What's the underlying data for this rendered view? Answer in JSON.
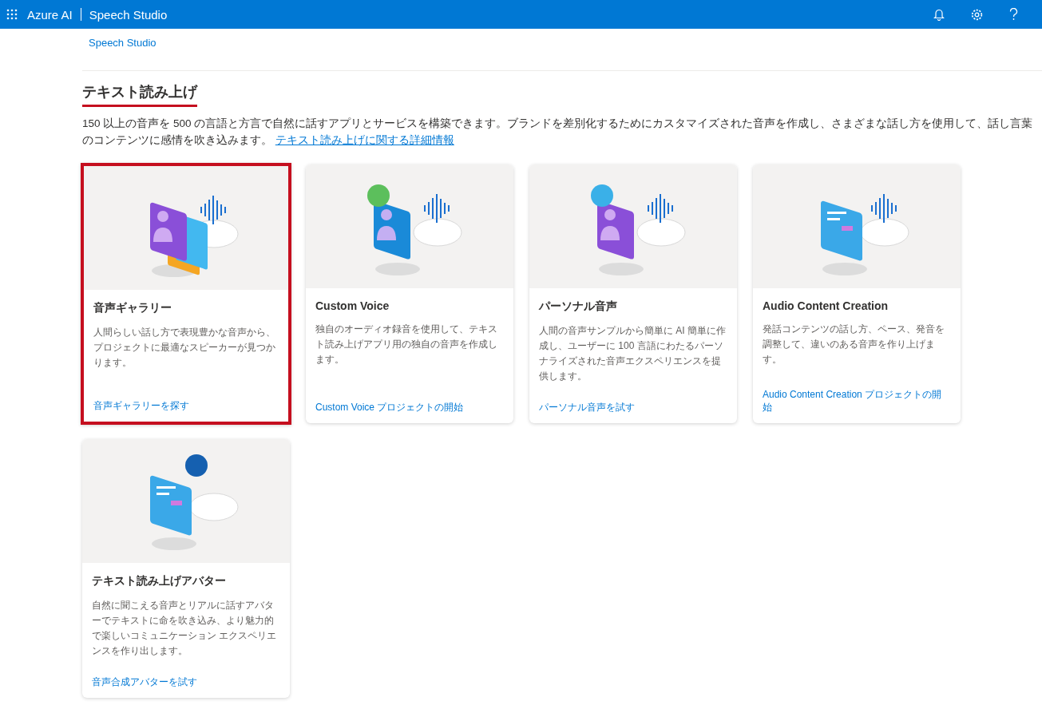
{
  "topbar": {
    "brand": "Azure AI",
    "product": "Speech Studio"
  },
  "breadcrumb": "Speech Studio",
  "heading": "テキスト読み上げ",
  "intro": {
    "text": "150 以上の音声を 500 の言語と方言で自然に話すアプリとサービスを構築できます。ブランドを差別化するためにカスタマイズされた音声を作成し、さまざまな話し方を使用して、話し言葉のコンテンツに感情を吹き込みます。",
    "link": "テキスト読み上げに関する詳細情報"
  },
  "cards": [
    {
      "kind": "gallery",
      "title": "音声ギャラリー",
      "description": "人間らしい話し方で表現豊かな音声から、プロジェクトに最適なスピーカーが見つかります。",
      "link": "音声ギャラリーを探す",
      "selected": true
    },
    {
      "kind": "custom",
      "title": "Custom Voice",
      "description": "独自のオーディオ録音を使用して、テキスト読み上げアプリ用の独自の音声を作成します。",
      "link": "Custom Voice プロジェクトの開始",
      "selected": false
    },
    {
      "kind": "personal",
      "title": "パーソナル音声",
      "description": "人間の音声サンプルから簡単に AI 簡単に作成し、ユーザーに 100 言語にわたるパーソナライズされた音声エクスペリエンスを提供します。",
      "link": "パーソナル音声を試す",
      "selected": false
    },
    {
      "kind": "content",
      "title": "Audio Content Creation",
      "description": "発話コンテンツの話し方、ペース、発音を調整して、違いのある音声を作り上げます。",
      "link": "Audio Content Creation プロジェクトの開始",
      "selected": false
    },
    {
      "kind": "avatar",
      "title": "テキスト読み上げアバター",
      "description": "自然に聞こえる音声とリアルに話すアバターでテキストに命を吹き込み、より魅力的で楽しいコミュニケーション エクスペリエンスを作り出します。",
      "link": "音声合成アバターを試す",
      "selected": false
    }
  ]
}
